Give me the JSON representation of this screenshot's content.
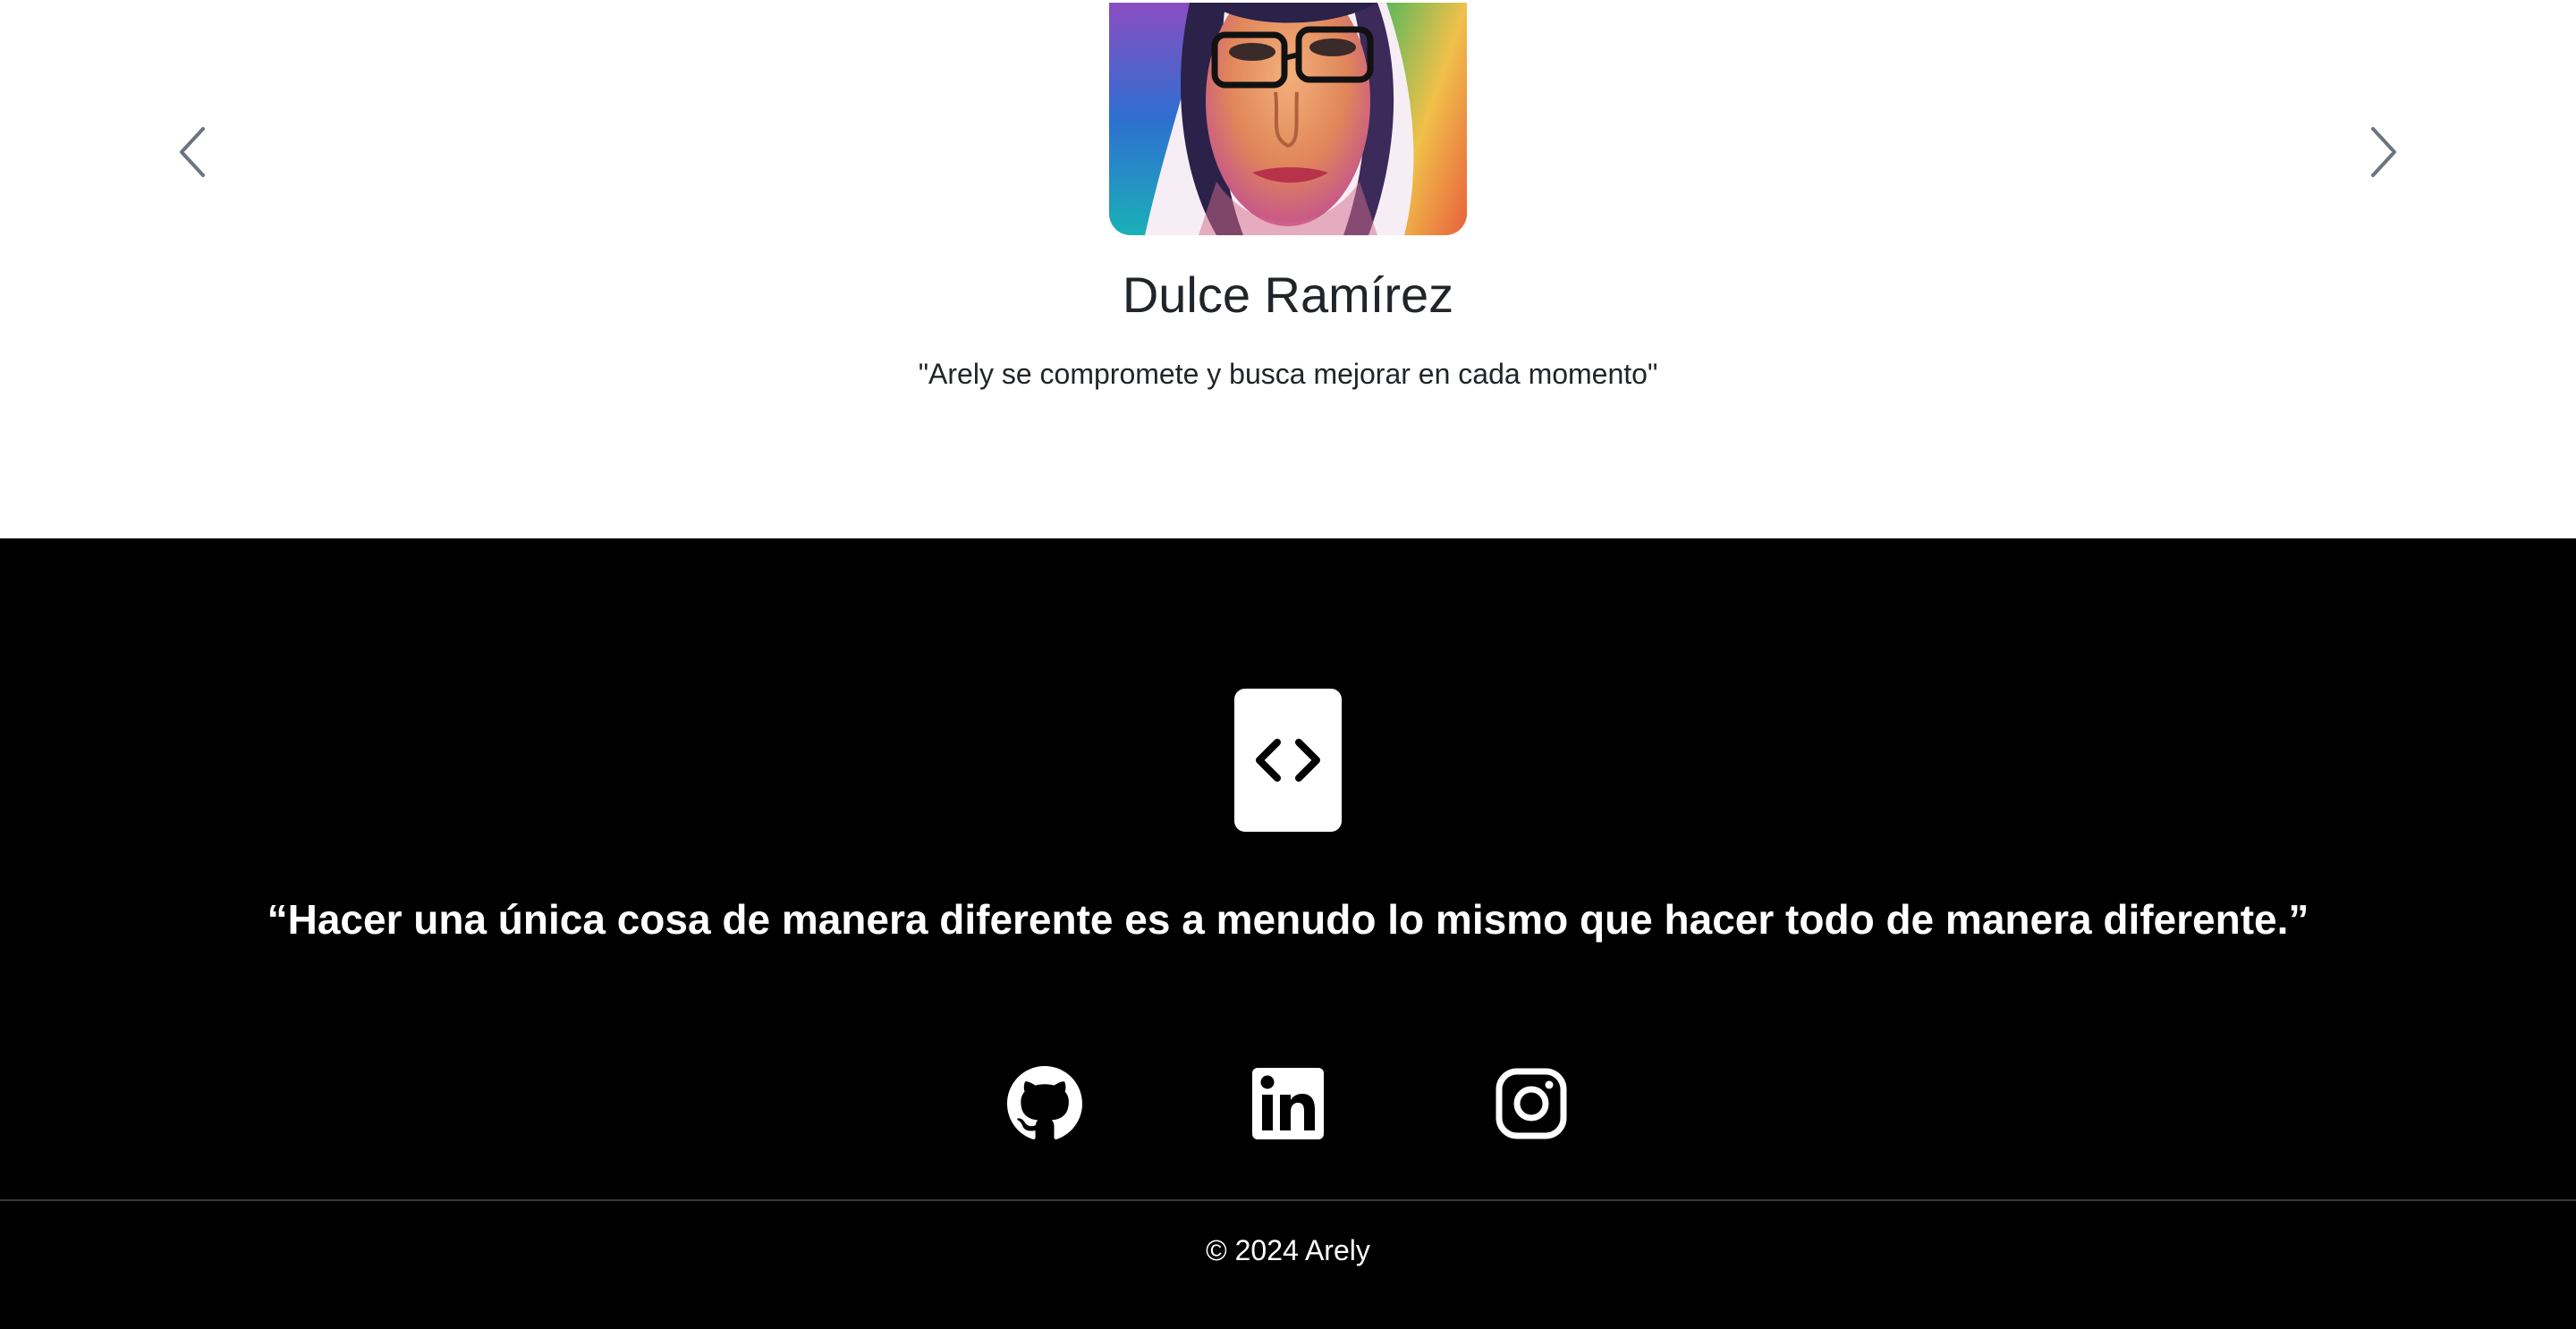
{
  "testimonial": {
    "name": "Dulce Ramírez",
    "quote": "\"Arely se compromete y busca mejorar en cada momento\"",
    "avatar_icon": "portrait-photo",
    "prev_icon": "chevron-left-icon",
    "next_icon": "chevron-right-icon"
  },
  "footer": {
    "logo_icon": "code-brackets-icon",
    "quote": "“Hacer una única cosa de manera diferente es a menudo lo mismo que hacer todo de manera diferente.”",
    "social": [
      {
        "name": "GitHub",
        "icon": "github-icon"
      },
      {
        "name": "LinkedIn",
        "icon": "linkedin-icon"
      },
      {
        "name": "Instagram",
        "icon": "instagram-icon"
      }
    ],
    "copyright": "© 2024 Arely"
  },
  "colors": {
    "footer_bg": "#000000",
    "text_dark": "#212529",
    "text_light": "#ffffff",
    "chevron": "#6c757d"
  }
}
